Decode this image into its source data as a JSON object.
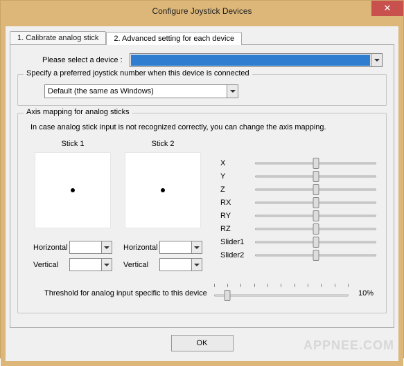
{
  "window": {
    "title": "Configure Joystick Devices"
  },
  "tabs": {
    "calibrate": "1. Calibrate analog stick",
    "advanced": "2. Advanced setting for each device"
  },
  "device": {
    "label": "Please select a device :",
    "selected": ""
  },
  "preferred": {
    "legend": "Specify a preferred joystick number when this device is connected",
    "selected": "Default (the same as Windows)"
  },
  "axis_mapping": {
    "legend": "Axis mapping for analog sticks",
    "hint": "In case analog stick input is not recognized correctly, you can change the axis mapping.",
    "stick1_title": "Stick 1",
    "stick2_title": "Stick 2",
    "horizontal_label": "Horizontal",
    "vertical_label": "Vertical",
    "stick1": {
      "horizontal": "",
      "vertical": ""
    },
    "stick2": {
      "horizontal": "",
      "vertical": ""
    },
    "axes": {
      "X": {
        "label": "X",
        "value": 50
      },
      "Y": {
        "label": "Y",
        "value": 50
      },
      "Z": {
        "label": "Z",
        "value": 50
      },
      "RX": {
        "label": "RX",
        "value": 50
      },
      "RY": {
        "label": "RY",
        "value": 50
      },
      "RZ": {
        "label": "RZ",
        "value": 50
      },
      "Slider1": {
        "label": "Slider1",
        "value": 50
      },
      "Slider2": {
        "label": "Slider2",
        "value": 50
      }
    },
    "threshold": {
      "label": "Threshold for analog input specific to this device",
      "value": 10,
      "display": "10%"
    }
  },
  "buttons": {
    "ok": "OK"
  },
  "watermark": "APPNEE.COM"
}
